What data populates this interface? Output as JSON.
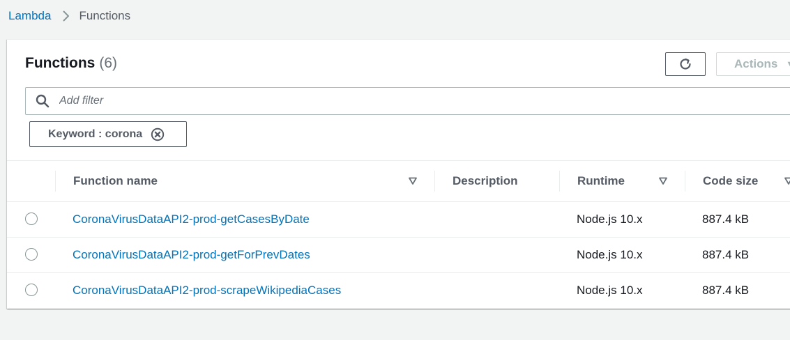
{
  "breadcrumb": {
    "root": "Lambda",
    "current": "Functions"
  },
  "panel": {
    "title": "Functions",
    "count": "(6)",
    "actions_label": "Actions"
  },
  "filter": {
    "placeholder": "Add filter",
    "token_label": "Keyword : corona"
  },
  "table": {
    "headers": {
      "function_name": "Function name",
      "description": "Description",
      "runtime": "Runtime",
      "code_size": "Code size"
    },
    "rows": [
      {
        "name": "CoronaVirusDataAPI2-prod-getCasesByDate",
        "description": "",
        "runtime": "Node.js 10.x",
        "code_size": "887.4 kB"
      },
      {
        "name": "CoronaVirusDataAPI2-prod-getForPrevDates",
        "description": "",
        "runtime": "Node.js 10.x",
        "code_size": "887.4 kB"
      },
      {
        "name": "CoronaVirusDataAPI2-prod-scrapeWikipediaCases",
        "description": "",
        "runtime": "Node.js 10.x",
        "code_size": "887.4 kB"
      }
    ]
  },
  "colors": {
    "link": "#0073bb",
    "text": "#16191f",
    "muted": "#545b64",
    "page_background": "#f2f3f3"
  }
}
